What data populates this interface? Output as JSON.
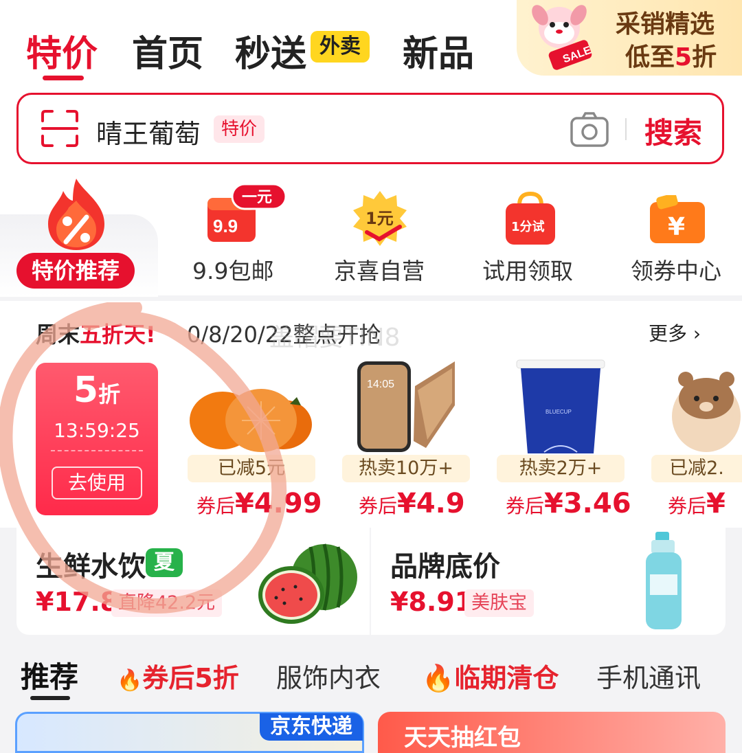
{
  "tabs": [
    {
      "label": "特价",
      "active": true
    },
    {
      "label": "首页"
    },
    {
      "label": "秒送"
    },
    {
      "label": "新品"
    }
  ],
  "waimai_badge": "外卖",
  "promo_banner": {
    "line1": "采销精选",
    "line2_pre": "低至",
    "line2_hl": "5",
    "line2_post": "折",
    "sale_text": "SALE"
  },
  "search": {
    "keyword": "晴王葡萄",
    "tag": "特价",
    "button": "搜索"
  },
  "categories": {
    "hot": {
      "label": "特价推荐",
      "icon": "percent-fire-icon"
    },
    "items": [
      {
        "label": "9.9包邮",
        "icon": "9.9-gift-icon",
        "badge": "一元",
        "icon_text": "9.9"
      },
      {
        "label": "京喜自营",
        "icon": "1yuan-starburst-icon",
        "icon_text": "1元"
      },
      {
        "label": "试用领取",
        "icon": "trial-bag-icon",
        "icon_text": "1分试"
      },
      {
        "label": "领券中心",
        "icon": "yen-coupon-icon",
        "icon_text": "¥"
      }
    ]
  },
  "weekend": {
    "title_pre": "周末",
    "title_hl": "五折天",
    "title_mark": "!",
    "date": "0/8/20/22整点开抢",
    "more": "更多",
    "coupon": {
      "discount": "5",
      "unit": "折",
      "timer": "13:59:25",
      "button": "去使用"
    },
    "products": [
      {
        "tag": "已减5元",
        "price_prefix": "券后",
        "price": "¥4.99",
        "image": "persimmon"
      },
      {
        "tag": "热卖10万+",
        "price_prefix": "券后",
        "price": "¥4.9",
        "image": "phone"
      },
      {
        "tag": "热卖2万+",
        "price_prefix": "券后",
        "price": "¥3.46",
        "image": "blue-cup"
      },
      {
        "tag": "已减2.",
        "price_prefix": "券后",
        "price": "¥",
        "image": "bear-toy"
      }
    ],
    "cup_text": "BLUECUP",
    "phone_time": "14:05"
  },
  "cards": {
    "fresh": {
      "title": "生鲜水饮",
      "season": "夏",
      "price": "¥17.8",
      "chip": "直降42.2元"
    },
    "brand": {
      "title": "品牌底价",
      "price": "¥8.91",
      "chip": "美肤宝"
    }
  },
  "bottom_tabs": [
    {
      "label": "推荐",
      "active": true
    },
    {
      "label": "券后5折",
      "icon": "percent-fire-icon"
    },
    {
      "label": "服饰内衣"
    },
    {
      "label": "临期清仓",
      "icon": "fire-icon"
    },
    {
      "label": "手机通讯"
    }
  ],
  "bottom_banners": {
    "left_label": "京东快递",
    "right_label": "天天抽红包"
  },
  "watermark": "盖帽要TIN8",
  "colors": {
    "accent": "#e6112e",
    "waimai": "#ffd61f",
    "coupon": "#ff2a4a"
  }
}
